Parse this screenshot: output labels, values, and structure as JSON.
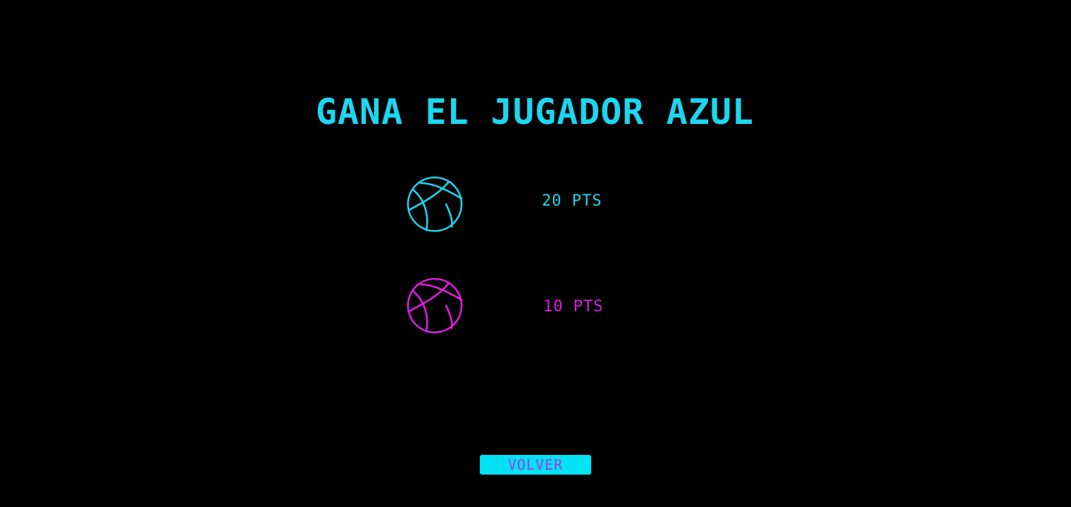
{
  "title": "GANA EL JUGADOR AZUL",
  "players": [
    {
      "icon": "basketball-icon",
      "score_label": "20 PTS",
      "color": "#1cd6f0"
    },
    {
      "icon": "basketball-icon",
      "score_label": "10 PTS",
      "color": "#e01ce0"
    }
  ],
  "back_button": {
    "label": "VOLVER",
    "background": "#00e1f5",
    "text_color": "#a23ce0"
  },
  "background": "#000000"
}
